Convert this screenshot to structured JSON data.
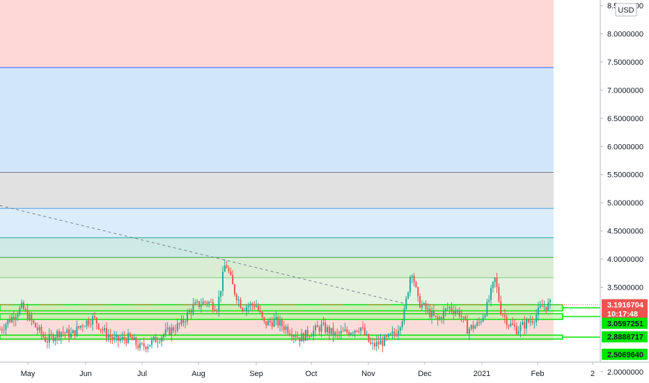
{
  "currency_button": "USD",
  "chart_data": {
    "type": "candlestick",
    "symbol_currency": "USD",
    "ylim": [
      1.8,
      8.6
    ],
    "y_ticks": [
      {
        "label": "8.5000000",
        "value": 8.5
      },
      {
        "label": "8.0000000",
        "value": 8.0
      },
      {
        "label": "7.5000000",
        "value": 7.5
      },
      {
        "label": "7.0000000",
        "value": 7.0
      },
      {
        "label": "6.5000000",
        "value": 6.5
      },
      {
        "label": "6.0000000",
        "value": 6.0
      },
      {
        "label": "5.5000000",
        "value": 5.5
      },
      {
        "label": "5.0000000",
        "value": 5.0
      },
      {
        "label": "4.5000000",
        "value": 4.5
      },
      {
        "label": "4.0000000",
        "value": 4.0
      },
      {
        "label": "3.5000000",
        "value": 3.5
      },
      {
        "label": "2.0000000",
        "value": 2.0
      }
    ],
    "x_labels": [
      "May",
      "Jun",
      "Jul",
      "Aug",
      "Sep",
      "Oct",
      "Nov",
      "Dec",
      "2021",
      "Feb",
      "2"
    ],
    "price_tags": [
      {
        "label": "3.1916704",
        "value": 3.19,
        "bg": "#ef5350",
        "fg": "#ffffff"
      },
      {
        "label": "10:17:48",
        "value": 3.03,
        "bg": "#ef5350",
        "fg": "#ffffff"
      },
      {
        "label": "3.0597251",
        "value": 2.86,
        "bg": "#00e600",
        "fg": "#131722"
      },
      {
        "label": "2.8888717",
        "value": 2.62,
        "bg": "#00e600",
        "fg": "#131722"
      },
      {
        "label": "2.5069640",
        "value": 2.31,
        "bg": "#00e600",
        "fg": "#131722"
      }
    ],
    "fib_zones": [
      {
        "from": 7.4,
        "to": 8.6,
        "fill": "#fdd8d6",
        "line": ""
      },
      {
        "from": 5.54,
        "to": 7.4,
        "fill": "#d1e6fb",
        "line": "#2962ff"
      },
      {
        "from": 4.9,
        "to": 5.54,
        "fill": "#e1e1e1",
        "line": "#787b86"
      },
      {
        "from": 4.38,
        "to": 4.9,
        "fill": "#dbedfc",
        "line": "#4d9ee8"
      },
      {
        "from": 4.03,
        "to": 4.38,
        "fill": "#cdeae6",
        "line": "#26a69a"
      },
      {
        "from": 3.67,
        "to": 4.03,
        "fill": "#d9edd5",
        "line": "#43a047"
      },
      {
        "from": 3.2,
        "to": 3.67,
        "fill": "#e5f2e1",
        "line": "#81c784"
      },
      {
        "from": 2.55,
        "to": 3.2,
        "fill": "#fbdcda",
        "line": ""
      }
    ],
    "support_bands": [
      {
        "from": 3.08,
        "to": 3.19
      },
      {
        "from": 2.93,
        "to": 3.03
      },
      {
        "from": 2.58,
        "to": 2.65
      }
    ],
    "trendline": {
      "x_start": 0.0,
      "y_start": 4.95,
      "x_end": 0.74,
      "y_end": 3.2
    },
    "current_price": 3.19,
    "series_keypoints": [
      [
        0.0,
        2.75
      ],
      [
        0.02,
        2.95
      ],
      [
        0.04,
        3.15
      ],
      [
        0.06,
        2.85
      ],
      [
        0.085,
        2.55
      ],
      [
        0.11,
        2.72
      ],
      [
        0.13,
        2.65
      ],
      [
        0.15,
        2.85
      ],
      [
        0.17,
        2.95
      ],
      [
        0.19,
        2.7
      ],
      [
        0.21,
        2.55
      ],
      [
        0.235,
        2.6
      ],
      [
        0.255,
        2.43
      ],
      [
        0.275,
        2.52
      ],
      [
        0.3,
        2.68
      ],
      [
        0.33,
        2.85
      ],
      [
        0.35,
        3.15
      ],
      [
        0.375,
        3.25
      ],
      [
        0.395,
        3.15
      ],
      [
        0.41,
        3.95
      ],
      [
        0.425,
        3.45
      ],
      [
        0.44,
        3.15
      ],
      [
        0.465,
        3.2
      ],
      [
        0.48,
        2.85
      ],
      [
        0.5,
        2.9
      ],
      [
        0.525,
        2.75
      ],
      [
        0.545,
        2.6
      ],
      [
        0.565,
        2.7
      ],
      [
        0.585,
        2.8
      ],
      [
        0.61,
        2.65
      ],
      [
        0.635,
        2.72
      ],
      [
        0.655,
        2.8
      ],
      [
        0.675,
        2.45
      ],
      [
        0.7,
        2.55
      ],
      [
        0.72,
        2.7
      ],
      [
        0.735,
        3.05
      ],
      [
        0.748,
        3.85
      ],
      [
        0.76,
        3.25
      ],
      [
        0.775,
        3.1
      ],
      [
        0.795,
        2.9
      ],
      [
        0.815,
        3.15
      ],
      [
        0.835,
        3.05
      ],
      [
        0.85,
        2.75
      ],
      [
        0.87,
        2.85
      ],
      [
        0.885,
        3.15
      ],
      [
        0.9,
        3.65
      ],
      [
        0.91,
        3.1
      ],
      [
        0.925,
        2.85
      ],
      [
        0.94,
        2.75
      ],
      [
        0.955,
        2.85
      ],
      [
        0.97,
        2.95
      ],
      [
        0.985,
        3.15
      ],
      [
        1.0,
        3.19
      ]
    ]
  }
}
